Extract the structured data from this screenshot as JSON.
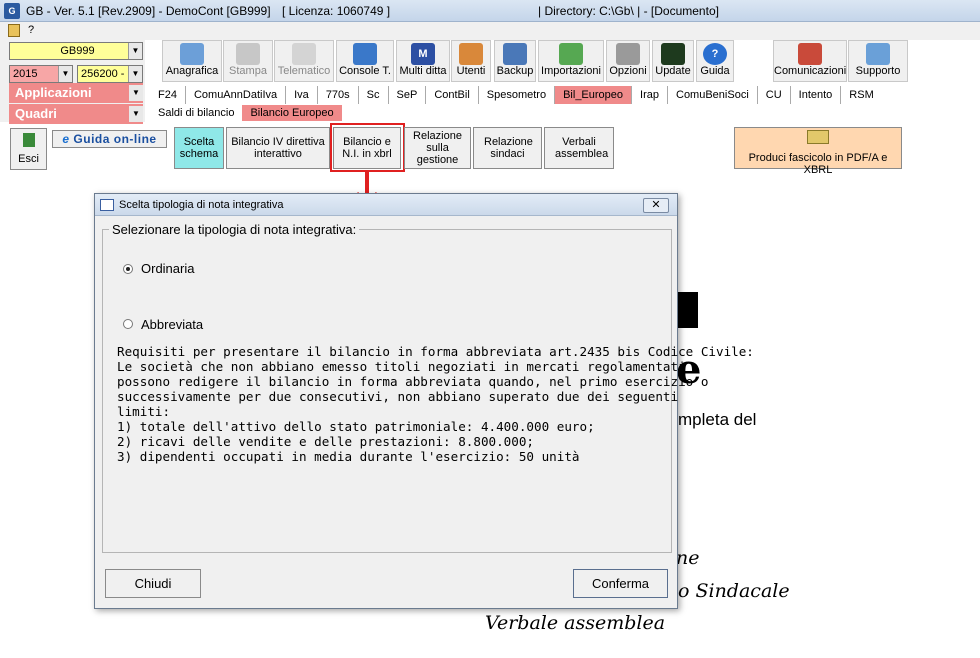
{
  "window": {
    "title": "GB - Ver. 5.1 [Rev.2909] - DemoCont [GB999]",
    "license": "[ Licenza: 1060749 ]",
    "directory": "| Directory: C:\\Gb\\ | - [Documento]",
    "menu_help": "?"
  },
  "left": {
    "company": "GB999",
    "year": "2015",
    "code": "256200 -",
    "applicazioni": "Applicazioni",
    "quadri": "Quadri"
  },
  "toolbar": [
    {
      "name": "anagrafica",
      "label": "Anagrafica"
    },
    {
      "name": "stampa",
      "label": "Stampa"
    },
    {
      "name": "telematico",
      "label": "Telematico"
    },
    {
      "name": "console",
      "label": "Console T."
    },
    {
      "name": "multiditta",
      "label": "Multi ditta"
    },
    {
      "name": "utenti",
      "label": "Utenti"
    },
    {
      "name": "backup",
      "label": "Backup"
    },
    {
      "name": "importazioni",
      "label": "Importazioni"
    },
    {
      "name": "opzioni",
      "label": "Opzioni"
    },
    {
      "name": "update",
      "label": "Update"
    },
    {
      "name": "guida",
      "label": "Guida"
    },
    {
      "name": "comunicazioni",
      "label": "Comunicazioni"
    },
    {
      "name": "supporto",
      "label": "Supporto"
    }
  ],
  "tabs": [
    "F24",
    "ComuAnnDatiIva",
    "Iva",
    "770s",
    "Sc",
    "SeP",
    "ContBil",
    "Spesometro",
    "Bil_Europeo",
    "Irap",
    "ComuBeniSoci",
    "CU",
    "Intento",
    "RSM"
  ],
  "subtabs": [
    "Saldi di bilancio",
    "Bilancio Europeo"
  ],
  "actions": {
    "esci": "Esci",
    "guida_online": "Guida on-line",
    "scelta": "Scelta schema",
    "bilancio_iv": "Bilancio IV direttiva interattivo",
    "bilancio_ni": "Bilancio e N.I. in xbrl",
    "relazione_gestione": "Relazione sulla gestione",
    "relazione_sindaci": "Relazione sindaci",
    "verbali": "Verbali assemblea",
    "produci": "Produci fascicolo in PDF/A e XBRL"
  },
  "background": {
    "line1": "mpleta del",
    "line2": "ne",
    "line3": "o Sindacale",
    "line4": "Verbale assemblea"
  },
  "dialog": {
    "title": "Scelta tipologia di nota integrativa",
    "group_label": "Selezionare la tipologia di nota integrativa:",
    "option1": "Ordinaria",
    "option2": "Abbreviata",
    "selected": "Ordinaria",
    "info": "Requisiti per presentare il bilancio in forma abbreviata art.2435 bis Codice Civile:\nLe società che non abbiano emesso titoli negoziati in mercati regolamentati\npossono redigere il bilancio in forma abbreviata quando, nel primo esercizio o\nsuccessivamente per due consecutivi, non abbiano superato due dei seguenti\nlimiti:\n1) totale dell'attivo dello stato patrimoniale: 4.400.000 euro;\n2) ricavi delle vendite e delle prestazioni: 8.800.000;\n3) dipendenti occupati in media durante l'esercizio: 50 unità",
    "close": "Chiudi",
    "confirm": "Conferma"
  },
  "colors": {
    "accent_red": "#e02020",
    "section_pink": "#f08a8a",
    "highlight_cyan": "#8fe8e8",
    "produci_bg": "#ffd7b0"
  }
}
